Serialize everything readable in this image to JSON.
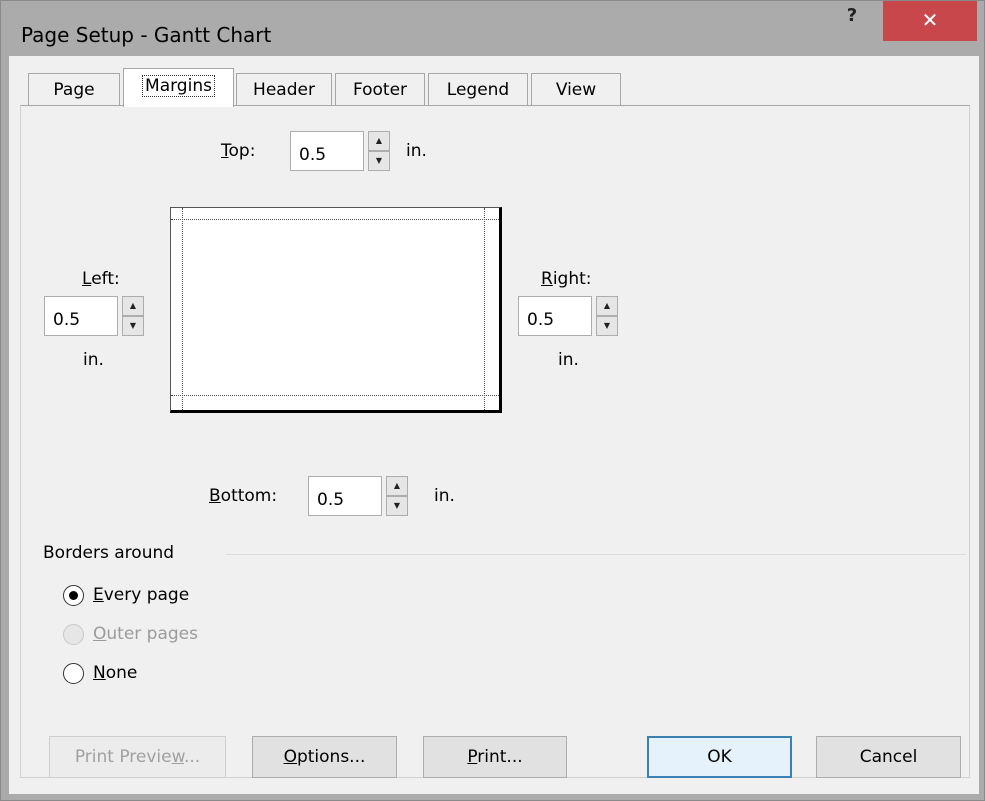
{
  "window": {
    "title": "Page Setup - Gantt Chart",
    "help_label": "?",
    "close_label": "✕"
  },
  "tabs": [
    {
      "label": "Page"
    },
    {
      "label": "Margins",
      "active": true
    },
    {
      "label": "Header"
    },
    {
      "label": "Footer"
    },
    {
      "label": "Legend"
    },
    {
      "label": "View"
    }
  ],
  "margins": {
    "top": {
      "label_key": "T",
      "label_rest": "op:",
      "value": "0.5",
      "unit": "in."
    },
    "left": {
      "label_key": "L",
      "label_rest": "eft:",
      "value": "0.5",
      "unit": "in."
    },
    "right": {
      "label_key": "R",
      "label_rest": "ight:",
      "value": "0.5",
      "unit": "in."
    },
    "bottom": {
      "label_key": "B",
      "label_rest": "ottom:",
      "value": "0.5",
      "unit": "in."
    }
  },
  "borders": {
    "group_title": "Borders around",
    "options": [
      {
        "key": "E",
        "rest": "very page",
        "checked": true,
        "enabled": true
      },
      {
        "key": "O",
        "rest": "uter pages",
        "checked": false,
        "enabled": false
      },
      {
        "key": "N",
        "rest": "one",
        "checked": false,
        "enabled": true
      }
    ]
  },
  "buttons": {
    "print_preview": {
      "pre": "Print Previe",
      "key": "w",
      "post": "..."
    },
    "options": {
      "key": "O",
      "rest": "ptions..."
    },
    "print": {
      "key": "P",
      "rest": "rint..."
    },
    "ok": "OK",
    "cancel": "Cancel"
  }
}
